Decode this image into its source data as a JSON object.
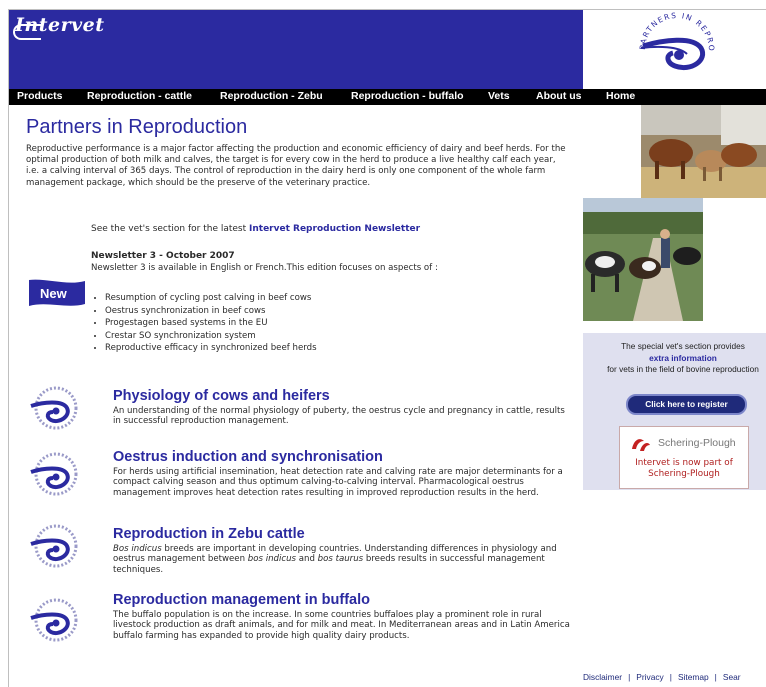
{
  "header": {
    "logo_text": "Intervet",
    "badge_text": "PARTNERS IN REPRODUCTION",
    "brand_color": "#2b2aa0"
  },
  "nav": [
    {
      "label": "Products"
    },
    {
      "label": "Reproduction - cattle"
    },
    {
      "label": "Reproduction - Zebu"
    },
    {
      "label": "Reproduction - buffalo"
    },
    {
      "label": "Vets"
    },
    {
      "label": "About us"
    },
    {
      "label": "Home"
    }
  ],
  "main": {
    "title": "Partners in Reproduction",
    "intro": "Reproductive performance is a major factor affecting the production and economic efficiency of dairy and beef herds. For the optimal production of both milk and calves, the target is for every cow in the herd to produce a live healthy calf each year, i.e. a calving interval of 365 days. The control of reproduction in the dairy herd is only one component of the whole farm management package, which should be the preserve of the veterinary practice.",
    "see_vets_prefix": "See the vet's section for the latest",
    "see_vets_link": "Intervet Reproduction Newsletter",
    "newsletter": {
      "badge": "New",
      "title": "Newsletter 3 - October 2007",
      "desc": "Newsletter 3 is available in English or French.This edition focuses on aspects of :",
      "items": [
        "Resumption of cycling post calving in beef cows",
        "Oestrus synchronization in beef cows",
        "Progestagen based systems in the EU",
        "Crestar SO synchronization system",
        "Reproductive efficacy in synchronized beef herds"
      ]
    },
    "sections": [
      {
        "title": "Physiology of cows and heifers",
        "body": "An understanding of the normal physiology of puberty, the oestrus cycle and pregnancy in cattle, results in successful reproduction management."
      },
      {
        "title": "Oestrus induction and synchronisation",
        "body": "For herds using artificial insemination, heat detection rate and calving rate are major determinants for a compact calving season and thus optimum calving-to-calving interval. Pharmacological oestrus management improves heat detection rates resulting in improved reproduction results in the herd."
      },
      {
        "title": "Reproduction in Zebu cattle",
        "body_em1": "Bos indicus",
        "body_mid1": " breeds are important in developing countries. Understanding differences in physiology and oestrus management between ",
        "body_em2": "bos indicus",
        "body_mid2": " and ",
        "body_em3": "bos taurus",
        "body_end": " breeds results in successful management techniques."
      },
      {
        "title": "Reproduction management in buffalo",
        "body": "The buffalo population is on the increase. In some countries buffaloes play a prominent role in rural livestock production as draft animals, and for milk and meat. In Mediterranean areas and in Latin America buffalo farming has expanded to provide high quality dairy products."
      }
    ]
  },
  "sidebar": {
    "vets_line1": "The special vet's section provides",
    "vets_line2": "extra information",
    "vets_line3": "for vets in the field of bovine reproduction",
    "register_button": "Click here to register",
    "sponsor_name": "Schering-Plough",
    "sponsor_note": "Intervet is now part of Schering-Plough"
  },
  "footer": {
    "links": [
      "Disclaimer",
      "Privacy",
      "Sitemap",
      "Sear"
    ]
  }
}
